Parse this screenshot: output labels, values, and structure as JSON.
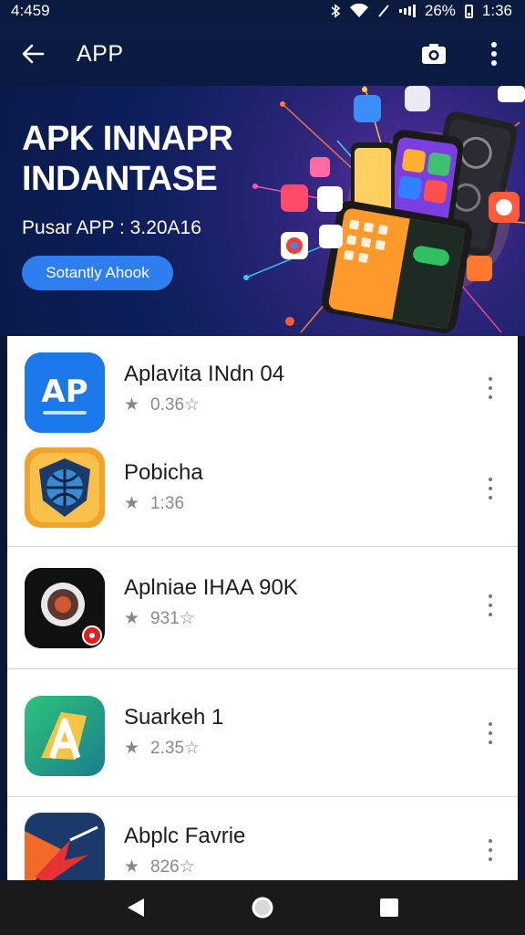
{
  "status_bar": {
    "time_left": "4:459",
    "battery": "26%",
    "time_right": "1:36"
  },
  "app_bar": {
    "title": "APP",
    "icons": [
      "back-arrow-icon",
      "camera-icon",
      "more-vert-icon"
    ]
  },
  "banner": {
    "headline_line1": "APK INNAPR",
    "headline_line2": "INDANTASE",
    "subtitle": "Pusar APP : 3.20A16",
    "cta_label": "Sotantly Ahook"
  },
  "apps": [
    {
      "name": "Aplavita INdn 04",
      "rating": "0.36☆",
      "icon": "ap-logo-icon",
      "icon_text": "AP"
    },
    {
      "name": "Pobicha",
      "rating": "1:36",
      "icon": "globe-shield-icon"
    },
    {
      "name": "Aplniae IHAA 90K",
      "rating": "931☆",
      "icon": "camera-lens-icon"
    },
    {
      "name": "Suarkeh 1",
      "rating": "2.35☆",
      "icon": "letter-a-icon"
    },
    {
      "name": "Abplc Favrie",
      "rating": "826☆",
      "icon": "red-arrow-icon"
    }
  ],
  "nav_bar": {
    "icons": [
      "back-triangle-icon",
      "home-circle-icon",
      "recents-square-icon"
    ]
  },
  "colors": {
    "app_bar": "#0c1c44",
    "accent": "#2f7ef0",
    "list_background": "#ffffff",
    "nav_bar": "#1a1a1a"
  }
}
